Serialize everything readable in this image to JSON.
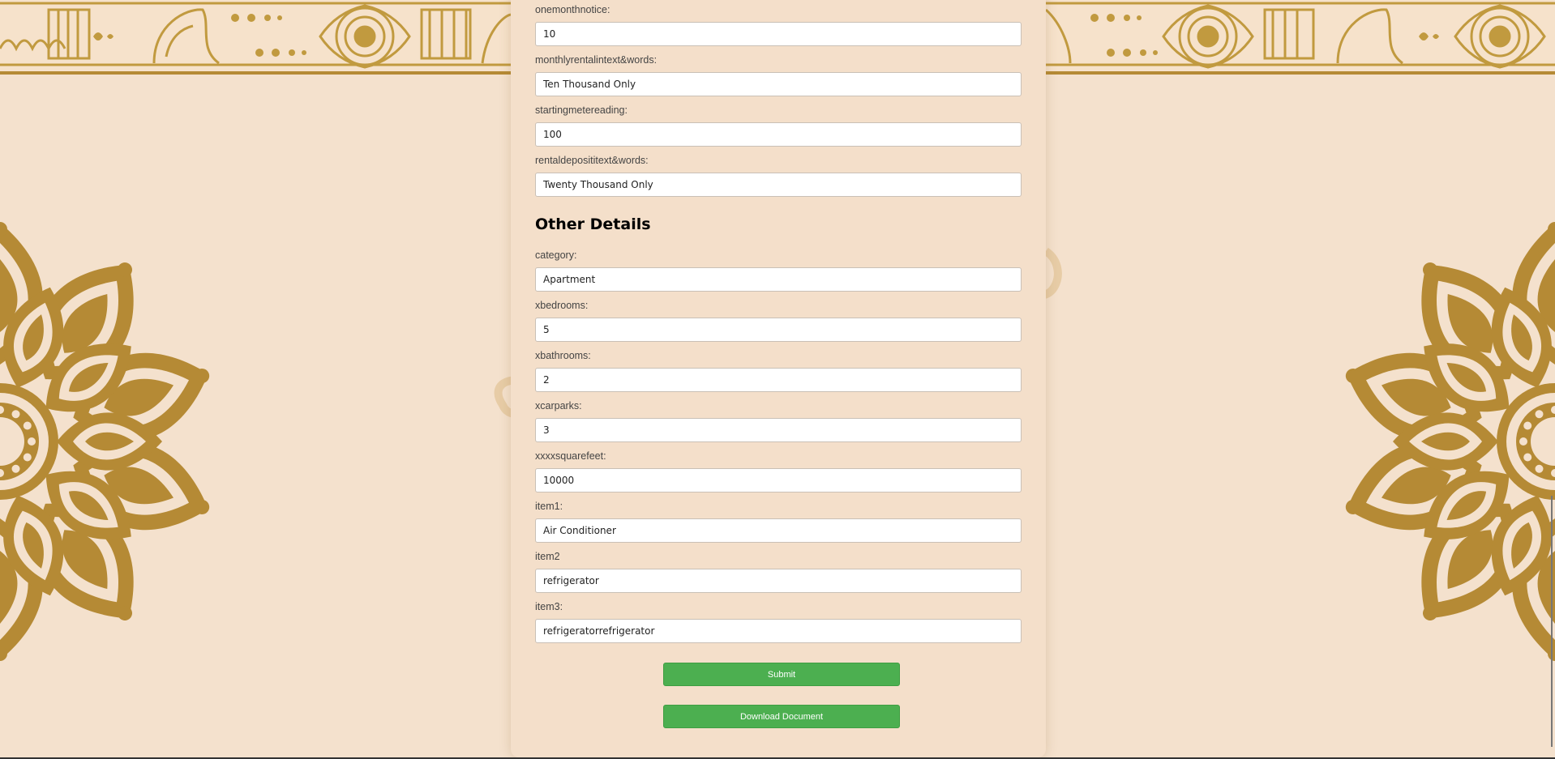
{
  "colors": {
    "background": "#f4e1cd",
    "card": "#f4dfca",
    "ornament": "#b58a35",
    "button": "#4caf50",
    "button_text": "#ffffff"
  },
  "decor": {
    "border_icon": "paisley-border-icon",
    "mandala_icon": "mandala-icon"
  },
  "form": {
    "rental_fields": [
      {
        "label": "onemonthnotice:",
        "value": "10"
      },
      {
        "label": "monthlyrentalintext&words:",
        "value": "Ten Thousand Only"
      },
      {
        "label": "startingmetereading:",
        "value": "100"
      },
      {
        "label": "rentaldeposititext&words:",
        "value": "Twenty Thousand Only"
      }
    ],
    "other_details": {
      "title": "Other Details",
      "fields": [
        {
          "label": "category:",
          "value": "Apartment"
        },
        {
          "label": "xbedrooms:",
          "value": "5"
        },
        {
          "label": "xbathrooms:",
          "value": "2"
        },
        {
          "label": "xcarparks:",
          "value": "3"
        },
        {
          "label": "xxxxsquarefeet:",
          "value": "10000"
        },
        {
          "label": "item1:",
          "value": "Air Conditioner"
        },
        {
          "label": "item2",
          "value": "refrigerator"
        },
        {
          "label": "item3:",
          "value": "refrigeratorrefrigerator"
        }
      ]
    },
    "buttons": {
      "submit": "Submit",
      "download": "Download Document"
    }
  }
}
